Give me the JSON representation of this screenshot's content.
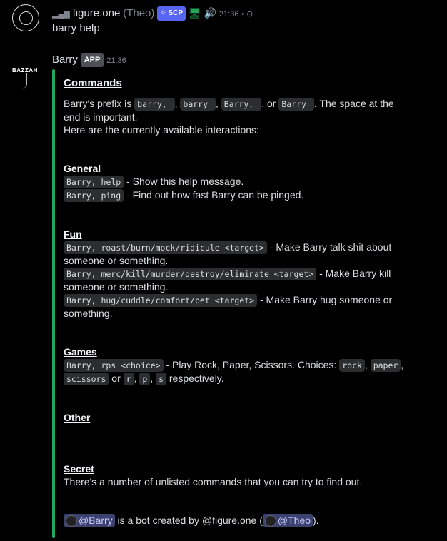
{
  "msg1": {
    "username": "figure.one",
    "display": "(Theo)",
    "badge": "SCP",
    "time": "21:36",
    "content": "barry help"
  },
  "msg2": {
    "username": "Barry",
    "app_badge": "APP",
    "time": "21:36",
    "avatar_text": "BAZZAH"
  },
  "embed": {
    "title": "Commands",
    "intro": {
      "t1": "Barry's prefix is",
      "p1": "barry, ",
      "p2": "barry ",
      "p3": "Barry, ",
      "p4": "Barry ",
      "t_or": ", or",
      "t_end": ". The space at the",
      "l2": "end is important.",
      "l3": "Here are the currently available interactions:"
    },
    "general": {
      "heading": "General",
      "help_cmd": "Barry, help",
      "help_desc": " - Show this help message.",
      "ping_cmd": "Barry, ping",
      "ping_desc": " - Find out how fast Barry can be pinged."
    },
    "fun": {
      "heading": "Fun",
      "roast_cmd": "Barry, roast/burn/mock/ridicule <target>",
      "roast_desc1": " - Make Barry talk shit about",
      "roast_desc2": "someone or something.",
      "merc_cmd": "Barry, merc/kill/murder/destroy/eliminate <target>",
      "merc_desc1": " - Make Barry kill",
      "merc_desc2": "someone or something.",
      "hug_cmd": "Barry, hug/cuddle/comfort/pet <target>",
      "hug_desc1": " - Make Barry hug someone or",
      "hug_desc2": "something."
    },
    "games": {
      "heading": "Games",
      "rps_cmd": "Barry, rps <choice>",
      "rps_desc": " - Play Rock, Paper, Scissors. Choices:",
      "rock": "rock",
      "paper": "paper",
      "scissors": "scissors",
      "or": "or",
      "r": "r",
      "p": "p",
      "s": "s",
      "respectively": "respectively."
    },
    "other": {
      "heading": "Other"
    },
    "secret": {
      "heading": "Secret",
      "desc": "There's a number of unlisted commands that you can try to find out."
    },
    "footer": {
      "mention1": "@Barry",
      "mid": " is a bot created by @figure.one (",
      "mention2": "@Theo",
      "end": ")."
    }
  }
}
